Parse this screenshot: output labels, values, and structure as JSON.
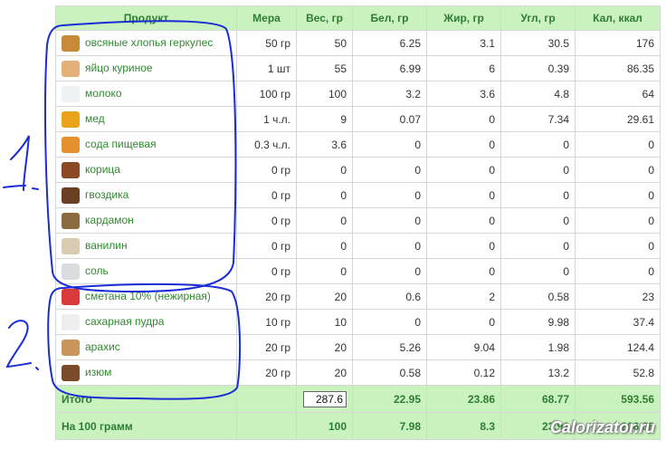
{
  "headers": [
    "Продукт",
    "Мера",
    "Вес, гр",
    "Бел, гр",
    "Жир, гр",
    "Угл, гр",
    "Кал, ккал"
  ],
  "rows": [
    {
      "name": "овсяные хлопья геркулес",
      "measure": "50 гр",
      "weight": "50",
      "protein": "6.25",
      "fat": "3.1",
      "carbs": "30.5",
      "kcal": "176",
      "icon": "oatmeal-pack-icon",
      "color": "#c88a3a"
    },
    {
      "name": "яйцо куриное",
      "measure": "1 шт",
      "weight": "55",
      "protein": "6.99",
      "fat": "6",
      "carbs": "0.39",
      "kcal": "86.35",
      "icon": "egg-icon",
      "color": "#e3b07a"
    },
    {
      "name": "молоко",
      "measure": "100 гр",
      "weight": "100",
      "protein": "3.2",
      "fat": "3.6",
      "carbs": "4.8",
      "kcal": "64",
      "icon": "milk-glass-icon",
      "color": "#eef2f5"
    },
    {
      "name": "мед",
      "measure": "1 ч.л.",
      "weight": "9",
      "protein": "0.07",
      "fat": "0",
      "carbs": "7.34",
      "kcal": "29.61",
      "icon": "honey-icon",
      "color": "#e9a21c"
    },
    {
      "name": "сода пищевая",
      "measure": "0.3 ч.л.",
      "weight": "3.6",
      "protein": "0",
      "fat": "0",
      "carbs": "0",
      "kcal": "0",
      "icon": "soda-box-icon",
      "color": "#e5902f"
    },
    {
      "name": "корица",
      "measure": "0 гр",
      "weight": "0",
      "protein": "0",
      "fat": "0",
      "carbs": "0",
      "kcal": "0",
      "icon": "cinnamon-icon",
      "color": "#8b4a25"
    },
    {
      "name": "гвоздика",
      "measure": "0 гр",
      "weight": "0",
      "protein": "0",
      "fat": "0",
      "carbs": "0",
      "kcal": "0",
      "icon": "clove-icon",
      "color": "#6b3e22"
    },
    {
      "name": "кардамон",
      "measure": "0 гр",
      "weight": "0",
      "protein": "0",
      "fat": "0",
      "carbs": "0",
      "kcal": "0",
      "icon": "cardamom-icon",
      "color": "#8a6a3e"
    },
    {
      "name": "ванилин",
      "measure": "0 гр",
      "weight": "0",
      "protein": "0",
      "fat": "0",
      "carbs": "0",
      "kcal": "0",
      "icon": "vanillin-icon",
      "color": "#d8cbb2"
    },
    {
      "name": "соль",
      "measure": "0 гр",
      "weight": "0",
      "protein": "0",
      "fat": "0",
      "carbs": "0",
      "kcal": "0",
      "icon": "salt-icon",
      "color": "#d9dde0"
    },
    {
      "name": "сметана 10% (нежирная)",
      "measure": "20 гр",
      "weight": "20",
      "protein": "0.6",
      "fat": "2",
      "carbs": "0.58",
      "kcal": "23",
      "icon": "sour-cream-icon",
      "color": "#d63a3a"
    },
    {
      "name": "сахарная пудра",
      "measure": "10 гр",
      "weight": "10",
      "protein": "0",
      "fat": "0",
      "carbs": "9.98",
      "kcal": "37.4",
      "icon": "powdered-sugar-icon",
      "color": "#eeeeee"
    },
    {
      "name": "арахис",
      "measure": "20 гр",
      "weight": "20",
      "protein": "5.26",
      "fat": "9.04",
      "carbs": "1.98",
      "kcal": "124.4",
      "icon": "peanut-icon",
      "color": "#c9955a"
    },
    {
      "name": "изюм",
      "measure": "20 гр",
      "weight": "20",
      "protein": "0.58",
      "fat": "0.12",
      "carbs": "13.2",
      "kcal": "52.8",
      "icon": "raisin-icon",
      "color": "#7a4a2a"
    }
  ],
  "total": {
    "label": "Итого",
    "weight": "287.6",
    "protein": "22.95",
    "fat": "23.86",
    "carbs": "68.77",
    "kcal": "593.56"
  },
  "per100": {
    "label": "На 100 грамм",
    "weight": "100",
    "protein": "7.98",
    "fat": "8.3",
    "carbs": "23.91",
    "kcal": "206.38"
  },
  "annotations": {
    "group1": "1.",
    "group2": "2."
  },
  "watermark": "Calorizator.ru"
}
